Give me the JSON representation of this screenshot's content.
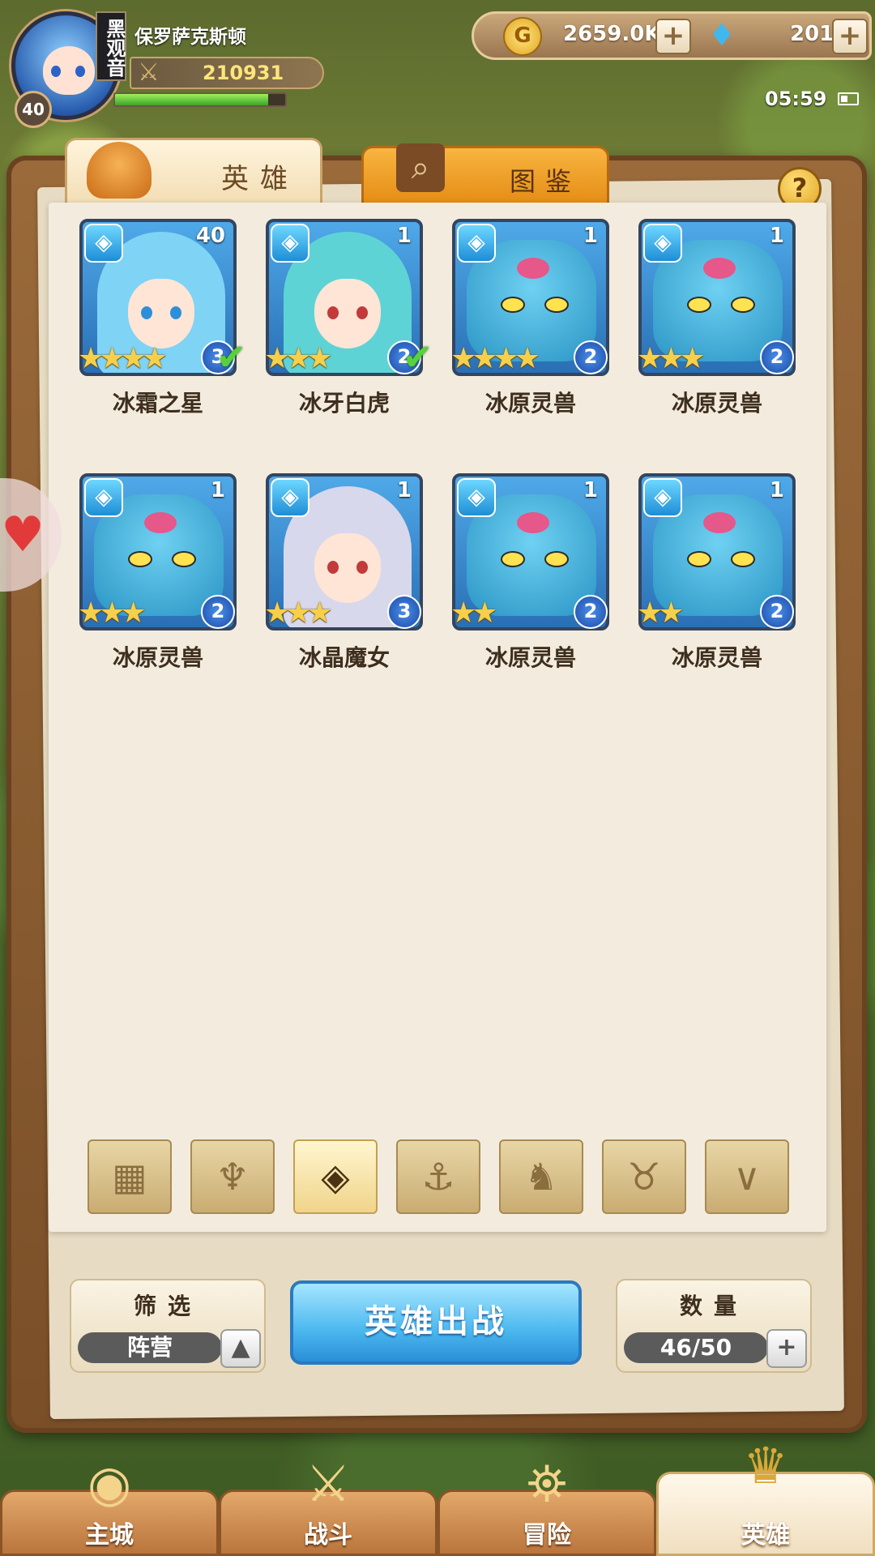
{
  "header": {
    "player_name": "保罗萨克斯顿",
    "rank_tag": "黑观音",
    "level": "40",
    "power": "210931",
    "exp_progress": 0.9,
    "gold": "2659.0K",
    "gems": "201",
    "clock": "05:59"
  },
  "tabs": {
    "heroes": "英雄",
    "codex": "图鉴"
  },
  "help_label": "?",
  "heroes": [
    {
      "name": "冰霜之星",
      "level": "40",
      "stars": "★★★★",
      "grade": "3",
      "deployed": true,
      "type": "girl-blue"
    },
    {
      "name": "冰牙白虎",
      "level": "1",
      "stars": "★★★",
      "grade": "2",
      "deployed": true,
      "type": "girl-teal"
    },
    {
      "name": "冰原灵兽",
      "level": "1",
      "stars": "★★★★",
      "grade": "2",
      "deployed": false,
      "type": "beast"
    },
    {
      "name": "冰原灵兽",
      "level": "1",
      "stars": "★★★",
      "grade": "2",
      "deployed": false,
      "type": "beast"
    },
    {
      "name": "冰原灵兽",
      "level": "1",
      "stars": "★★★",
      "grade": "2",
      "deployed": false,
      "type": "beast"
    },
    {
      "name": "冰晶魔女",
      "level": "1",
      "stars": "★★★",
      "grade": "3",
      "deployed": false,
      "type": "girl-silver"
    },
    {
      "name": "冰原灵兽",
      "level": "1",
      "stars": "★★",
      "grade": "2",
      "deployed": false,
      "type": "beast"
    },
    {
      "name": "冰原灵兽",
      "level": "1",
      "stars": "★★",
      "grade": "2",
      "deployed": false,
      "type": "beast"
    }
  ],
  "filters": [
    {
      "icon": "all-grid-icon",
      "glyph": "▦",
      "active": false
    },
    {
      "icon": "flame-faction-icon",
      "glyph": "♆",
      "active": false
    },
    {
      "icon": "ice-faction-icon",
      "glyph": "◈",
      "active": true
    },
    {
      "icon": "anchor-faction-icon",
      "glyph": "⚓",
      "active": false
    },
    {
      "icon": "beast-faction-icon",
      "glyph": "♞",
      "active": false
    },
    {
      "icon": "fox-faction-icon",
      "glyph": "♉",
      "active": false
    },
    {
      "icon": "wing-faction-icon",
      "glyph": "∨",
      "active": false
    }
  ],
  "controls": {
    "filter_title": "筛选",
    "filter_value": "阵营",
    "deploy_label": "英雄出战",
    "count_title": "数量",
    "count_value": "46/50"
  },
  "nav": [
    {
      "label": "主城",
      "icon": "castle-icon",
      "glyph": "◉",
      "active": false
    },
    {
      "label": "战斗",
      "icon": "crossed-swords-icon",
      "glyph": "⚔",
      "active": false
    },
    {
      "label": "冒险",
      "icon": "map-scroll-icon",
      "glyph": "⛯",
      "active": false
    },
    {
      "label": "英雄",
      "icon": "hero-helmet-icon",
      "glyph": "♛",
      "active": true
    }
  ],
  "colors": {
    "accent_gold": "#f0d48a",
    "deploy_blue": "#4bb8ef",
    "element_ice": "#1e8ed6"
  }
}
